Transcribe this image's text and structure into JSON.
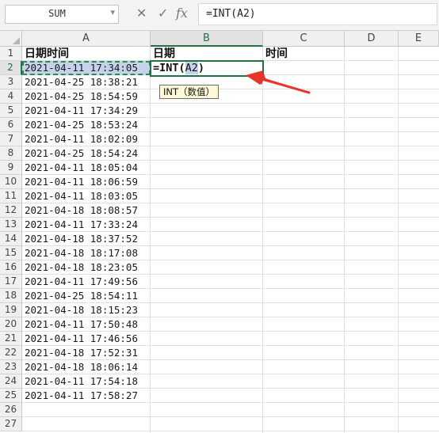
{
  "formula_bar": {
    "name_box": "SUM",
    "cancel_icon": "✕",
    "enter_icon": "✓",
    "fx_label": "fx",
    "formula": "=INT(A2)"
  },
  "columns": [
    "A",
    "B",
    "C",
    "D",
    "E"
  ],
  "rows": [
    "1",
    "2",
    "3",
    "4",
    "5",
    "6",
    "7",
    "8",
    "9",
    "10",
    "11",
    "12",
    "13",
    "14",
    "15",
    "16",
    "17",
    "18",
    "19",
    "20",
    "21",
    "22",
    "23",
    "24",
    "25",
    "26",
    "27"
  ],
  "headers": {
    "a1": "日期时间",
    "b1": "日期",
    "c1": "时间"
  },
  "b2": {
    "prefix": "=INT(",
    "ref": "A2",
    "suffix": ")"
  },
  "tooltip": "INT（数值）",
  "datetimes": [
    "2021-04-11 17:34:05",
    "2021-04-25 18:38:21",
    "2021-04-25 18:54:59",
    "2021-04-11 17:34:29",
    "2021-04-25 18:53:24",
    "2021-04-11 18:02:09",
    "2021-04-25 18:54:24",
    "2021-04-11 18:05:04",
    "2021-04-11 18:06:59",
    "2021-04-11 18:03:05",
    "2021-04-18 18:08:57",
    "2021-04-11 17:33:24",
    "2021-04-18 18:37:52",
    "2021-04-18 18:17:08",
    "2021-04-18 18:23:05",
    "2021-04-11 17:49:56",
    "2021-04-25 18:54:11",
    "2021-04-18 18:15:23",
    "2021-04-11 17:50:48",
    "2021-04-11 17:46:56",
    "2021-04-18 17:52:31",
    "2021-04-18 18:06:14",
    "2021-04-11 17:54:18",
    "2021-04-11 17:58:27"
  ],
  "colors": {
    "accent_green": "#217346",
    "ref_highlight": "#c5d3ea",
    "annotation_arrow": "#e8352b"
  }
}
